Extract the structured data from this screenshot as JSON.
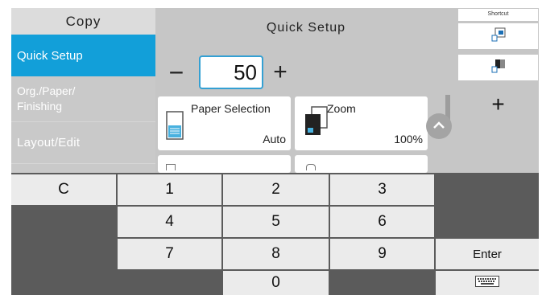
{
  "sidebar": {
    "header": "Copy",
    "items": [
      {
        "label": "Quick Setup",
        "selected": true
      },
      {
        "label_line1": "Org./Paper/",
        "label_line2": "Finishing"
      },
      {
        "label": "Layout/Edit"
      }
    ]
  },
  "main": {
    "title": "Quick Setup",
    "quantity": {
      "minus": "−",
      "value": "50",
      "plus": "+"
    },
    "cards": [
      {
        "label": "Paper Selection",
        "value": "Auto",
        "icon": "paper-tray-icon"
      },
      {
        "label": "Zoom",
        "value": "100%",
        "icon": "zoom-icon"
      }
    ]
  },
  "shortcut": {
    "header": "Shortcut",
    "add": "+"
  },
  "keypad": {
    "clear": "C",
    "keys": [
      "1",
      "2",
      "3",
      "4",
      "5",
      "6",
      "7",
      "8",
      "9",
      "0"
    ],
    "enter": "Enter",
    "keyboard_icon": "keyboard-icon"
  },
  "colors": {
    "accent": "#129fd9",
    "panel": "#c6c6c6",
    "keypad": "#5b5b5b"
  }
}
